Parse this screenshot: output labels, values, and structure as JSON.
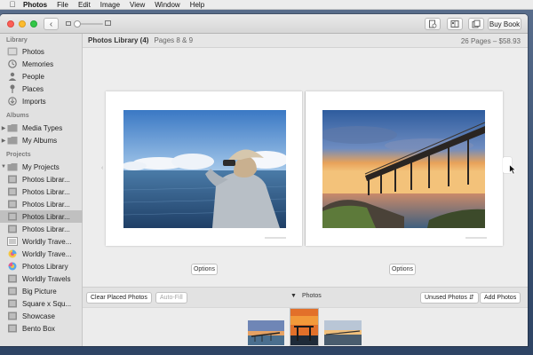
{
  "menubar": {
    "app": "Photos",
    "items": [
      "File",
      "Edit",
      "Image",
      "View",
      "Window",
      "Help"
    ]
  },
  "toolbar": {
    "back_glyph": "‹",
    "buy_book_label": "Buy Book",
    "icons": [
      "book-settings-icon",
      "layout-icon",
      "add-page-icon"
    ]
  },
  "sidebar": {
    "library_header": "Library",
    "library_items": [
      "Photos",
      "Memories",
      "People",
      "Places",
      "Imports"
    ],
    "albums_header": "Albums",
    "album_items": [
      "Media Types",
      "My Albums"
    ],
    "projects_header": "Projects",
    "project_items": [
      "My Projects",
      "Photos Librar...",
      "Photos Librar...",
      "Photos Librar...",
      "Photos Librar...",
      "Photos Librar...",
      "Worldly Trave...",
      "Worldly Trave...",
      "Photos Library",
      "Worldly Travels",
      "Big Picture",
      "Square x Squ...",
      "Showcase",
      "Bento Box"
    ]
  },
  "content": {
    "library_title": "Photos Library (4)",
    "pages_label": "Pages 8 & 9",
    "page_count": "26 Pages – $58.93",
    "options_label": "Options"
  },
  "bottombar": {
    "clear_label": "Clear Placed Photos",
    "autofill_label": "Auto-Fill",
    "photos_label": "Photos",
    "filter_label": "Unused Photos",
    "add_label": "Add Photos"
  },
  "colors": {
    "sidebar_selection": "#c0c0c0",
    "desktop": "#3f5677"
  }
}
